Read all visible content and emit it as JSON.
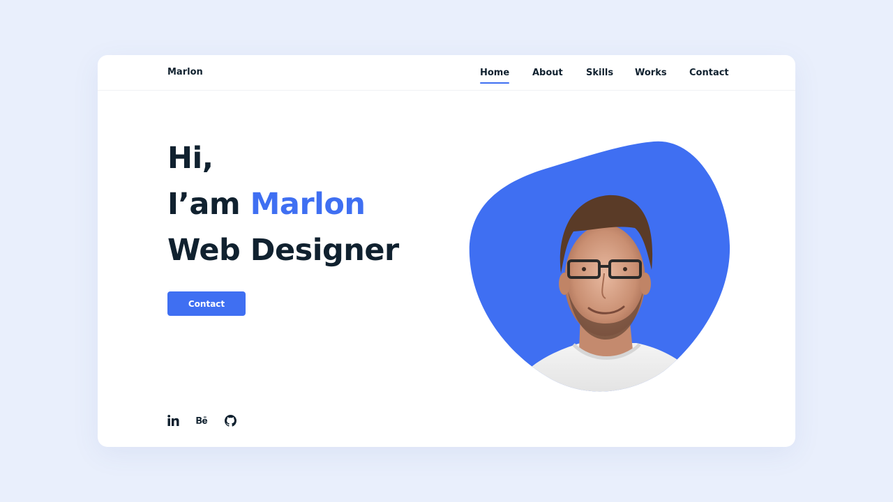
{
  "header": {
    "logo": "Marlon",
    "nav": [
      {
        "label": "Home",
        "active": true
      },
      {
        "label": "About",
        "active": false
      },
      {
        "label": "Skills",
        "active": false
      },
      {
        "label": "Works",
        "active": false
      },
      {
        "label": "Contact",
        "active": false
      }
    ]
  },
  "hero": {
    "line1": "Hi,",
    "line2_prefix": "I’am ",
    "line2_name": "Marlon",
    "line3": "Web Designer",
    "cta_label": "Contact",
    "image_alt": "Portrait of Marlon"
  },
  "socials": [
    {
      "icon": "linkedin-icon",
      "label": "in"
    },
    {
      "icon": "behance-icon",
      "label": "Bē"
    },
    {
      "icon": "github-icon",
      "label": "GitHub"
    }
  ],
  "colors": {
    "accent": "#3f6ff2",
    "text": "#10212f",
    "page_bg": "#e9effc",
    "card_bg": "#ffffff"
  }
}
